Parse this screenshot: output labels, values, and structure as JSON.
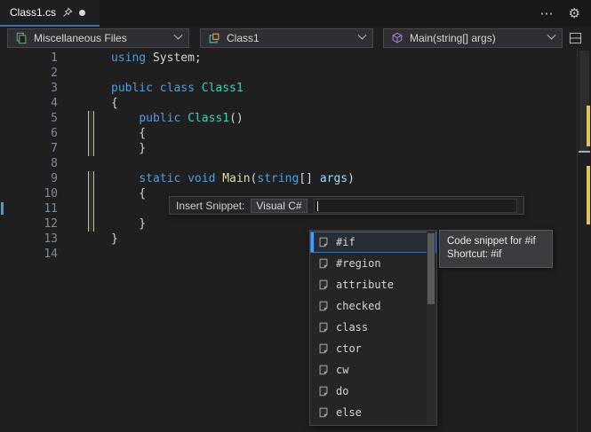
{
  "tab": {
    "title": "Class1.cs"
  },
  "icons": {
    "more": "⋯",
    "gear": "⚙"
  },
  "navbar": {
    "project": "Miscellaneous Files",
    "type": "Class1",
    "member": "Main(string[] args)"
  },
  "editor": {
    "lines": [
      {
        "num": "1",
        "changed": false,
        "tokens": [
          {
            "text": "using",
            "type": "kw"
          },
          {
            "text": " System;",
            "type": "pl"
          }
        ]
      },
      {
        "num": "2",
        "changed": false,
        "tokens": []
      },
      {
        "num": "3",
        "changed": false,
        "tokens": [
          {
            "text": "public class ",
            "type": "kw"
          },
          {
            "text": "Class1",
            "type": "cls"
          }
        ]
      },
      {
        "num": "4",
        "changed": false,
        "tokens": [
          {
            "text": "{",
            "type": "pl"
          }
        ]
      },
      {
        "num": "5",
        "changed": true,
        "tokens": [
          {
            "text": "    ",
            "type": "pl"
          },
          {
            "text": "public ",
            "type": "kw"
          },
          {
            "text": "Class1",
            "type": "cls"
          },
          {
            "text": "()",
            "type": "pl"
          }
        ]
      },
      {
        "num": "6",
        "changed": true,
        "tokens": [
          {
            "text": "    {",
            "type": "pl"
          }
        ]
      },
      {
        "num": "7",
        "changed": true,
        "tokens": [
          {
            "text": "    }",
            "type": "pl"
          }
        ]
      },
      {
        "num": "8",
        "changed": false,
        "tokens": []
      },
      {
        "num": "9",
        "changed": true,
        "tokens": [
          {
            "text": "    ",
            "type": "pl"
          },
          {
            "text": "static void ",
            "type": "kw"
          },
          {
            "text": "Main",
            "type": "fn"
          },
          {
            "text": "(",
            "type": "pl"
          },
          {
            "text": "string",
            "type": "kw"
          },
          {
            "text": "[] ",
            "type": "pl"
          },
          {
            "text": "args",
            "type": "param"
          },
          {
            "text": ")",
            "type": "pl"
          }
        ]
      },
      {
        "num": "10",
        "changed": true,
        "tokens": [
          {
            "text": "    {",
            "type": "pl"
          }
        ]
      },
      {
        "num": "11",
        "changed": true,
        "caret": true,
        "tokens": []
      },
      {
        "num": "12",
        "changed": true,
        "tokens": [
          {
            "text": "    }",
            "type": "pl"
          }
        ]
      },
      {
        "num": "13",
        "changed": false,
        "tokens": [
          {
            "text": "}",
            "type": "pl"
          }
        ]
      },
      {
        "num": "14",
        "changed": false,
        "tokens": []
      }
    ]
  },
  "snippet_popup": {
    "label": "Insert Snippet:",
    "path": "Visual C#"
  },
  "completion": {
    "selected_index": 0,
    "items": [
      {
        "label": "#if"
      },
      {
        "label": "#region"
      },
      {
        "label": "attribute"
      },
      {
        "label": "checked"
      },
      {
        "label": "class"
      },
      {
        "label": "ctor"
      },
      {
        "label": "cw"
      },
      {
        "label": "do"
      },
      {
        "label": "else"
      }
    ]
  },
  "tooltip": {
    "lines": [
      "Code snippet for #if",
      "Shortcut: #if"
    ]
  }
}
